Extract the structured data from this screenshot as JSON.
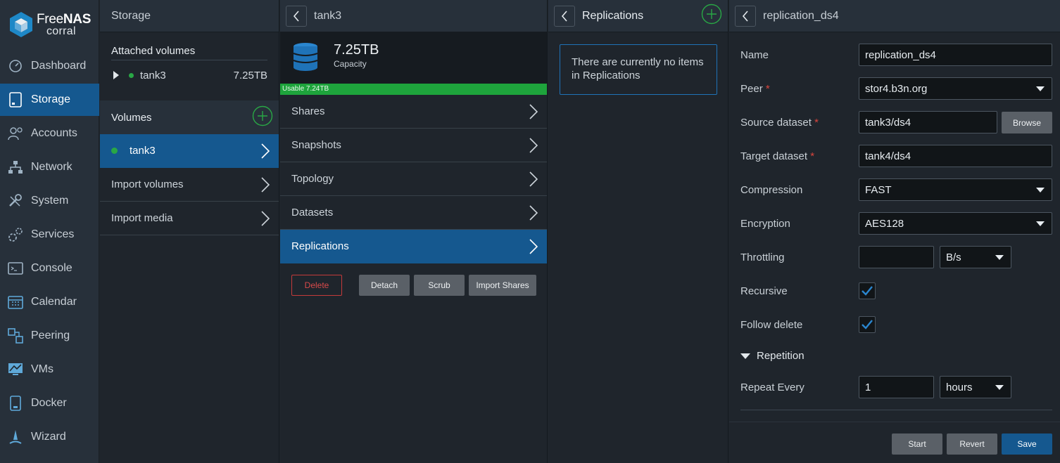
{
  "logo": {
    "brand_a": "Free",
    "brand_b": "NAS",
    "brand_sub": "corral"
  },
  "sidebar": {
    "items": [
      {
        "label": "Dashboard",
        "icon": "dashboard-icon"
      },
      {
        "label": "Storage",
        "icon": "storage-icon",
        "active": true
      },
      {
        "label": "Accounts",
        "icon": "accounts-icon"
      },
      {
        "label": "Network",
        "icon": "network-icon"
      },
      {
        "label": "System",
        "icon": "system-icon"
      },
      {
        "label": "Services",
        "icon": "services-icon"
      },
      {
        "label": "Console",
        "icon": "console-icon"
      },
      {
        "label": "Calendar",
        "icon": "calendar-icon"
      },
      {
        "label": "Peering",
        "icon": "peering-icon"
      },
      {
        "label": "VMs",
        "icon": "vms-icon"
      },
      {
        "label": "Docker",
        "icon": "docker-icon"
      },
      {
        "label": "Wizard",
        "icon": "wizard-icon"
      }
    ]
  },
  "storage": {
    "title": "Storage",
    "attached_title": "Attached volumes",
    "attached": [
      {
        "name": "tank3",
        "size": "7.25TB"
      }
    ],
    "volumes_title": "Volumes",
    "volumes": [
      {
        "name": "tank3"
      }
    ],
    "import_volumes": "Import volumes",
    "import_media": "Import media"
  },
  "tank": {
    "title": "tank3",
    "capacity": "7.25TB",
    "capacity_label": "Capacity",
    "usable": "Usable 7.24TB",
    "usable_fraction": 1.0,
    "items": [
      "Shares",
      "Snapshots",
      "Topology",
      "Datasets",
      "Replications"
    ],
    "selected": "Replications",
    "buttons": {
      "delete": "Delete",
      "detach": "Detach",
      "scrub": "Scrub",
      "import_shares": "Import Shares"
    }
  },
  "replications": {
    "title": "Replications",
    "empty_text": "There are currently no items in Replications"
  },
  "form": {
    "title": "replication_ds4",
    "name_label": "Name",
    "name_value": "replication_ds4",
    "peer_label": "Peer",
    "peer_value": "stor4.b3n.org",
    "source_label": "Source dataset",
    "source_value": "tank3/ds4",
    "browse": "Browse",
    "target_label": "Target dataset",
    "target_value": "tank4/ds4",
    "compression_label": "Compression",
    "compression_value": "FAST",
    "encryption_label": "Encryption",
    "encryption_value": "AES128",
    "throttling_label": "Throttling",
    "throttling_value": "",
    "throttling_unit": "B/s",
    "recursive_label": "Recursive",
    "recursive_checked": true,
    "follow_delete_label": "Follow delete",
    "follow_delete_checked": true,
    "repetition_label": "Repetition",
    "repeat_label": "Repeat Every",
    "repeat_value": "1",
    "repeat_unit": "hours",
    "buttons": {
      "start": "Start",
      "revert": "Revert",
      "save": "Save"
    },
    "required_mark": "*"
  },
  "colors": {
    "accent": "#15588f",
    "success": "#29a745",
    "danger": "#d9453d"
  }
}
